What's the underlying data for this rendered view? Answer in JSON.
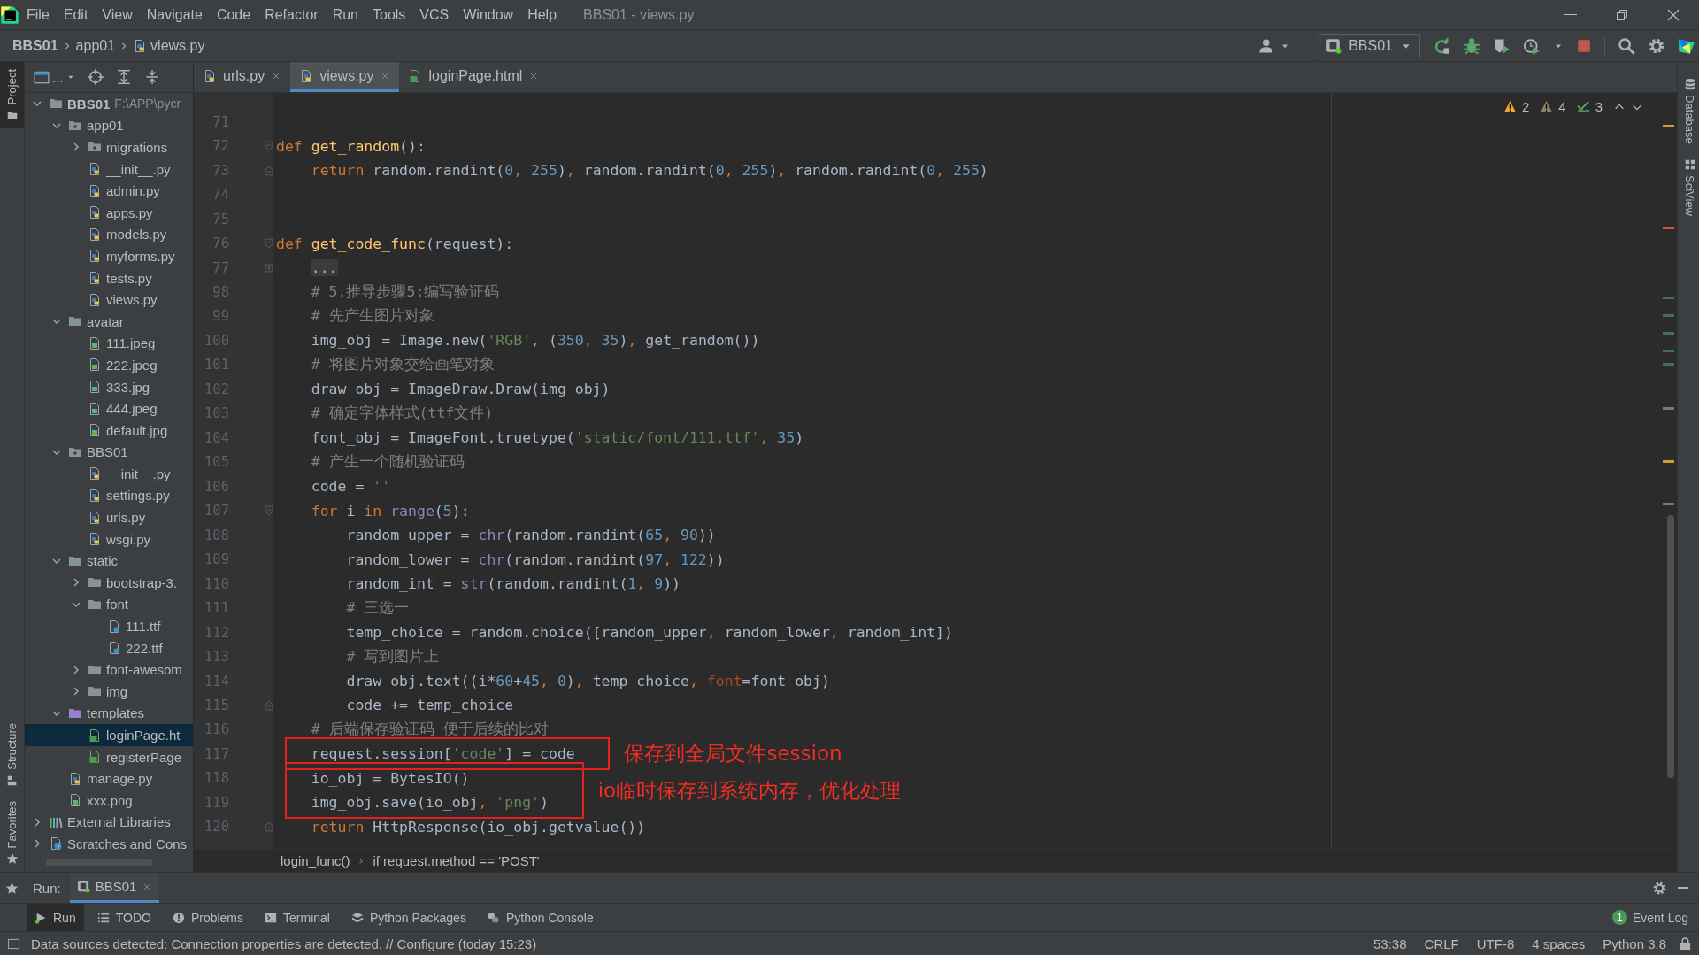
{
  "window": {
    "title": "BBS01 - views.py"
  },
  "menu": [
    "File",
    "Edit",
    "View",
    "Navigate",
    "Code",
    "Refactor",
    "Run",
    "Tools",
    "VCS",
    "Window",
    "Help"
  ],
  "navigation_bar": {
    "path": [
      "BBS01",
      "app01",
      "views.py"
    ],
    "run_configuration": "BBS01"
  },
  "side_tools": {
    "left": [
      {
        "label": "Project",
        "kind": "project",
        "selected": true
      },
      {
        "label": "Structure",
        "kind": "structure",
        "selected": false
      },
      {
        "label": "Favorites",
        "kind": "favorites",
        "selected": false
      }
    ],
    "right": [
      {
        "label": "Database",
        "kind": "database",
        "selected": false
      },
      {
        "label": "SciView",
        "kind": "sciview",
        "selected": false
      }
    ]
  },
  "project_panel": {
    "view_selector": "...",
    "tree": [
      {
        "name": "BBS01",
        "path": "F:\\APP\\pycr",
        "kind": "folder",
        "expanded": true,
        "selected": false,
        "children": [
          {
            "name": "app01",
            "kind": "package",
            "expanded": true,
            "selected": false,
            "children": [
              {
                "name": "migrations",
                "kind": "package",
                "expanded": false,
                "selected": false
              },
              {
                "name": "__init__.py",
                "kind": "python",
                "selected": false
              },
              {
                "name": "admin.py",
                "kind": "python",
                "selected": false
              },
              {
                "name": "apps.py",
                "kind": "python",
                "selected": false
              },
              {
                "name": "models.py",
                "kind": "python",
                "selected": false
              },
              {
                "name": "myforms.py",
                "kind": "python",
                "selected": false
              },
              {
                "name": "tests.py",
                "kind": "python",
                "selected": false
              },
              {
                "name": "views.py",
                "kind": "python",
                "selected": false
              }
            ]
          },
          {
            "name": "avatar",
            "kind": "folder",
            "expanded": true,
            "selected": false,
            "children": [
              {
                "name": "111.jpeg",
                "kind": "image",
                "selected": false
              },
              {
                "name": "222.jpeg",
                "kind": "image",
                "selected": false
              },
              {
                "name": "333.jpg",
                "kind": "image",
                "selected": false
              },
              {
                "name": "444.jpeg",
                "kind": "image",
                "selected": false
              },
              {
                "name": "default.jpg",
                "kind": "image",
                "selected": false
              }
            ]
          },
          {
            "name": "BBS01",
            "kind": "package",
            "expanded": true,
            "selected": false,
            "children": [
              {
                "name": "__init__.py",
                "kind": "python",
                "selected": false
              },
              {
                "name": "settings.py",
                "kind": "python",
                "selected": false
              },
              {
                "name": "urls.py",
                "kind": "python",
                "selected": false
              },
              {
                "name": "wsgi.py",
                "kind": "python",
                "selected": false
              }
            ]
          },
          {
            "name": "static",
            "kind": "folder",
            "expanded": true,
            "selected": false,
            "children": [
              {
                "name": "bootstrap-3.",
                "kind": "folder",
                "expanded": false,
                "selected": false
              },
              {
                "name": "font",
                "kind": "folder",
                "expanded": true,
                "selected": false,
                "children": [
                  {
                    "name": "111.ttf",
                    "kind": "font",
                    "selected": false
                  },
                  {
                    "name": "222.ttf",
                    "kind": "font",
                    "selected": false
                  }
                ]
              },
              {
                "name": "font-awesom",
                "kind": "folder",
                "expanded": false,
                "selected": false
              },
              {
                "name": "img",
                "kind": "folder",
                "expanded": false,
                "selected": false
              }
            ]
          },
          {
            "name": "templates",
            "kind": "templates",
            "expanded": true,
            "selected": false,
            "children": [
              {
                "name": "loginPage.ht",
                "kind": "html",
                "selected": true
              },
              {
                "name": "registerPage",
                "kind": "html",
                "selected": false
              }
            ]
          },
          {
            "name": "manage.py",
            "kind": "python",
            "selected": false
          },
          {
            "name": "xxx.png",
            "kind": "image",
            "selected": false
          }
        ]
      },
      {
        "name": "External Libraries",
        "kind": "library",
        "expanded": false,
        "selected": false
      },
      {
        "name": "Scratches and Cons",
        "kind": "scratch",
        "expanded": false,
        "selected": false
      }
    ]
  },
  "editor_tabs": [
    {
      "label": "urls.py",
      "kind": "python",
      "selected": false
    },
    {
      "label": "views.py",
      "kind": "python",
      "selected": true
    },
    {
      "label": "loginPage.html",
      "kind": "html",
      "selected": false
    }
  ],
  "inspections": {
    "warnings": "2",
    "weak_warnings": "4",
    "typos": "3"
  },
  "code_lines": [
    {
      "number": "71",
      "boxed": false
    },
    {
      "number": "72",
      "boxed": false,
      "tokens": [
        {
          "kind": "keyword",
          "text": "def"
        },
        {
          "kind": "function",
          "text": " get_random"
        },
        {
          "kind": "plain",
          "text": "():"
        }
      ],
      "children": [
        {
          "number": "73",
          "boxed": false,
          "tokens": [
            {
              "kind": "keyword",
              "text": "return"
            },
            {
              "kind": "plain",
              "text": " random.randint("
            },
            {
              "kind": "number",
              "text": "0"
            },
            {
              "kind": "keyword",
              "text": ", "
            },
            {
              "kind": "number",
              "text": "255"
            },
            {
              "kind": "plain",
              "text": ")"
            },
            {
              "kind": "keyword",
              "text": ", "
            },
            {
              "kind": "plain",
              "text": "random.randint("
            },
            {
              "kind": "number",
              "text": "0"
            },
            {
              "kind": "keyword",
              "text": ", "
            },
            {
              "kind": "number",
              "text": "255"
            },
            {
              "kind": "plain",
              "text": ")"
            },
            {
              "kind": "keyword",
              "text": ", "
            },
            {
              "kind": "plain",
              "text": "random.randint("
            },
            {
              "kind": "number",
              "text": "0"
            },
            {
              "kind": "keyword",
              "text": ", "
            },
            {
              "kind": "number",
              "text": "255"
            },
            {
              "kind": "plain",
              "text": ")"
            }
          ]
        }
      ]
    },
    {
      "number": "74",
      "boxed": false
    },
    {
      "number": "75",
      "boxed": false
    },
    {
      "number": "76",
      "boxed": false,
      "tokens": [
        {
          "kind": "keyword",
          "text": "def"
        },
        {
          "kind": "function",
          "text": " get_code_func"
        },
        {
          "kind": "plain",
          "text": "(request):"
        }
      ],
      "children": [
        {
          "number": "77",
          "boxed": false,
          "tokens": [
            {
              "kind": "folded",
              "text": "..."
            }
          ]
        },
        {
          "number": "98",
          "boxed": false,
          "tokens": [
            {
              "kind": "comment",
              "text": "# 5.推导步骤5:编写验证码"
            }
          ]
        },
        {
          "number": "99",
          "boxed": false,
          "tokens": [
            {
              "kind": "comment",
              "text": "# 先产生图片对象"
            }
          ]
        },
        {
          "number": "100",
          "boxed": false,
          "tokens": [
            {
              "kind": "plain",
              "text": "img_obj = Image.new("
            },
            {
              "kind": "string",
              "text": "'RGB'"
            },
            {
              "kind": "keyword",
              "text": ", "
            },
            {
              "kind": "plain",
              "text": "("
            },
            {
              "kind": "number",
              "text": "350"
            },
            {
              "kind": "keyword",
              "text": ", "
            },
            {
              "kind": "number",
              "text": "35"
            },
            {
              "kind": "plain",
              "text": ")"
            },
            {
              "kind": "keyword",
              "text": ", "
            },
            {
              "kind": "plain",
              "text": "get_random())"
            }
          ]
        },
        {
          "number": "101",
          "boxed": false,
          "tokens": [
            {
              "kind": "comment",
              "text": "# 将图片对象交给画笔对象"
            }
          ]
        },
        {
          "number": "102",
          "boxed": false,
          "tokens": [
            {
              "kind": "plain",
              "text": "draw_obj = ImageDraw.Draw(img_obj)"
            }
          ]
        },
        {
          "number": "103",
          "boxed": false,
          "tokens": [
            {
              "kind": "comment",
              "text": "# 确定字体样式(ttf文件)"
            }
          ]
        },
        {
          "number": "104",
          "boxed": false,
          "tokens": [
            {
              "kind": "plain",
              "text": "font_obj = ImageFont.truetype("
            },
            {
              "kind": "string",
              "text": "'static/font/111.ttf'"
            },
            {
              "kind": "keyword",
              "text": ", "
            },
            {
              "kind": "number",
              "text": "35"
            },
            {
              "kind": "plain",
              "text": ")"
            }
          ]
        },
        {
          "number": "105",
          "boxed": false,
          "tokens": [
            {
              "kind": "comment",
              "text": "# 产生一个随机验证码"
            }
          ]
        },
        {
          "number": "106",
          "boxed": false,
          "tokens": [
            {
              "kind": "plain",
              "text": "code = "
            },
            {
              "kind": "string",
              "text": "''"
            }
          ]
        },
        {
          "number": "107",
          "boxed": false,
          "tokens": [
            {
              "kind": "keyword",
              "text": "for"
            },
            {
              "kind": "plain",
              "text": " i "
            },
            {
              "kind": "keyword",
              "text": "in"
            },
            {
              "kind": "builtin",
              "text": " range"
            },
            {
              "kind": "plain",
              "text": "("
            },
            {
              "kind": "number",
              "text": "5"
            },
            {
              "kind": "plain",
              "text": "):"
            }
          ],
          "children": [
            {
              "number": "108",
              "boxed": false,
              "tokens": [
                {
                  "kind": "plain",
                  "text": "random_upper = "
                },
                {
                  "kind": "builtin",
                  "text": "chr"
                },
                {
                  "kind": "plain",
                  "text": "(random.randint("
                },
                {
                  "kind": "number",
                  "text": "65"
                },
                {
                  "kind": "keyword",
                  "text": ", "
                },
                {
                  "kind": "number",
                  "text": "90"
                },
                {
                  "kind": "plain",
                  "text": "))"
                }
              ]
            },
            {
              "number": "109",
              "boxed": false,
              "tokens": [
                {
                  "kind": "plain",
                  "text": "random_lower = "
                },
                {
                  "kind": "builtin",
                  "text": "chr"
                },
                {
                  "kind": "plain",
                  "text": "(random.randint("
                },
                {
                  "kind": "number",
                  "text": "97"
                },
                {
                  "kind": "keyword",
                  "text": ", "
                },
                {
                  "kind": "number",
                  "text": "122"
                },
                {
                  "kind": "plain",
                  "text": "))"
                }
              ]
            },
            {
              "number": "110",
              "boxed": false,
              "tokens": [
                {
                  "kind": "plain",
                  "text": "random_int = "
                },
                {
                  "kind": "builtin",
                  "text": "str"
                },
                {
                  "kind": "plain",
                  "text": "(random.randint("
                },
                {
                  "kind": "number",
                  "text": "1"
                },
                {
                  "kind": "keyword",
                  "text": ", "
                },
                {
                  "kind": "number",
                  "text": "9"
                },
                {
                  "kind": "plain",
                  "text": "))"
                }
              ]
            },
            {
              "number": "111",
              "boxed": false,
              "tokens": [
                {
                  "kind": "comment",
                  "text": "# 三选一"
                }
              ]
            },
            {
              "number": "112",
              "boxed": false,
              "tokens": [
                {
                  "kind": "plain",
                  "text": "temp_choice = random.choice([random_upper"
                },
                {
                  "kind": "keyword",
                  "text": ", "
                },
                {
                  "kind": "plain",
                  "text": "random_lower"
                },
                {
                  "kind": "keyword",
                  "text": ", "
                },
                {
                  "kind": "plain",
                  "text": "random_int])"
                }
              ]
            },
            {
              "number": "113",
              "boxed": false,
              "tokens": [
                {
                  "kind": "comment",
                  "text": "# 写到图片上"
                }
              ]
            },
            {
              "number": "114",
              "boxed": false,
              "tokens": [
                {
                  "kind": "plain",
                  "text": "draw_obj.text((i*"
                },
                {
                  "kind": "number",
                  "text": "60"
                },
                {
                  "kind": "plain",
                  "text": "+"
                },
                {
                  "kind": "number",
                  "text": "45"
                },
                {
                  "kind": "keyword",
                  "text": ", "
                },
                {
                  "kind": "number",
                  "text": "0"
                },
                {
                  "kind": "plain",
                  "text": ")"
                },
                {
                  "kind": "keyword",
                  "text": ", "
                },
                {
                  "kind": "plain",
                  "text": "temp_choice"
                },
                {
                  "kind": "keyword",
                  "text": ", "
                },
                {
                  "kind": "argument",
                  "text": "font"
                },
                {
                  "kind": "plain",
                  "text": "=font_obj)"
                }
              ]
            },
            {
              "number": "115",
              "boxed": false,
              "tokens": [
                {
                  "kind": "plain",
                  "text": "code += temp_choice"
                }
              ]
            }
          ]
        },
        {
          "number": "116",
          "boxed": false,
          "tokens": [
            {
              "kind": "comment",
              "text": "# 后端保存验证码 便于后续的比对"
            }
          ]
        },
        {
          "number": "117",
          "boxed": true,
          "note": "保存到全局文件session",
          "tokens": [
            {
              "kind": "plain",
              "text": "request.session["
            },
            {
              "kind": "string",
              "text": "'code'"
            },
            {
              "kind": "plain",
              "text": "] = code"
            }
          ]
        },
        {
          "number": "118",
          "boxed": true,
          "note": "io临时保存到系统内存，优化处理",
          "tokens": [
            {
              "kind": "plain",
              "text": "io_obj = BytesIO()"
            }
          ]
        },
        {
          "number": "119",
          "boxed": true,
          "tokens": [
            {
              "kind": "plain",
              "text": "img_obj.save(io_obj"
            },
            {
              "kind": "keyword",
              "text": ", "
            },
            {
              "kind": "string",
              "text": "'png'"
            },
            {
              "kind": "plain",
              "text": ")"
            }
          ]
        },
        {
          "number": "120",
          "boxed": false,
          "tokens": [
            {
              "kind": "keyword",
              "text": "return"
            },
            {
              "kind": "plain",
              "text": " HttpResponse(io_obj.getvalue())"
            }
          ]
        }
      ]
    }
  ],
  "editor_breadcrumb": [
    "login_func()",
    "if request.method == 'POST'"
  ],
  "run_panel": {
    "label": "Run:",
    "tabs": [
      {
        "label": "BBS01",
        "selected": true
      }
    ]
  },
  "tool_windows": [
    {
      "label": "Run",
      "kind": "run",
      "selected": true
    },
    {
      "label": "TODO",
      "kind": "todo",
      "selected": false
    },
    {
      "label": "Problems",
      "kind": "problems",
      "selected": false
    },
    {
      "label": "Terminal",
      "kind": "terminal",
      "selected": false
    },
    {
      "label": "Python Packages",
      "kind": "packages",
      "selected": false
    },
    {
      "label": "Python Console",
      "kind": "console",
      "selected": false
    }
  ],
  "event_log": {
    "label": "Event Log",
    "count": "1"
  },
  "status_bar": {
    "message": "Data sources detected: Connection properties are detected. // Configure (today 15:23)",
    "position": "53:38",
    "line_separator": "CRLF",
    "encoding": "UTF-8",
    "indent": "4 spaces",
    "interpreter": "Python 3.8"
  }
}
